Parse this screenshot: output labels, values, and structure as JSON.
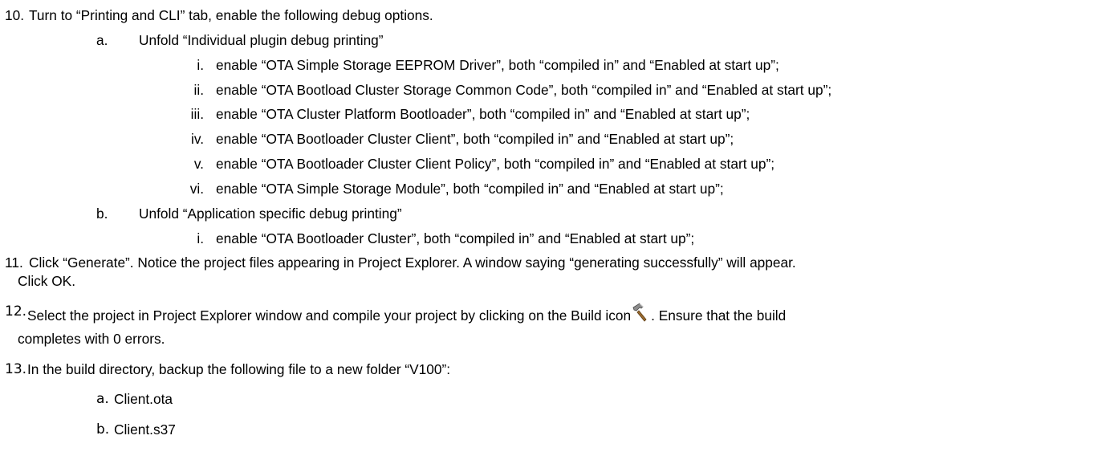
{
  "steps": [
    {
      "number": "10.",
      "text": "Turn to “Printing and CLI” tab, enable the following debug options.",
      "substeps": [
        {
          "marker": "a.",
          "text": "Unfold “Individual plugin debug printing”",
          "items": [
            {
              "marker": "i.",
              "text": "enable “OTA Simple Storage EEPROM Driver”, both “compiled in” and “Enabled at start up”;"
            },
            {
              "marker": "ii.",
              "text": "enable “OTA Bootload Cluster Storage Common Code”, both “compiled in” and “Enabled at start up”;"
            },
            {
              "marker": "iii.",
              "text": "enable “OTA Cluster Platform Bootloader”, both “compiled in” and “Enabled at start up”;"
            },
            {
              "marker": "iv.",
              "text": "enable “OTA Bootloader Cluster Client”, both “compiled in” and “Enabled at start up”;"
            },
            {
              "marker": "v.",
              "text": "enable “OTA Bootloader Cluster Client Policy”, both “compiled in” and “Enabled at start up”;"
            },
            {
              "marker": "vi.",
              "text": "enable “OTA Simple Storage Module”, both “compiled in” and “Enabled at start up”;"
            }
          ]
        },
        {
          "marker": "b.",
          "text": "Unfold “Application specific debug printing”",
          "items": [
            {
              "marker": "i.",
              "text": "enable “OTA Bootloader Cluster”, both “compiled in” and “Enabled at start up”;"
            }
          ]
        }
      ]
    },
    {
      "number": "11.",
      "text_line1": "Click “Generate”. Notice the project files appearing in Project Explorer. A window saying “generating successfully” will appear.",
      "text_line2": "Click OK."
    },
    {
      "number": "12.",
      "text_before_icon": "Select the project in Project Explorer window and compile your project by clicking on the Build icon",
      "icon": "hammer-build-icon",
      "text_after_icon": ". Ensure that the build",
      "text_line2": "completes with 0 errors."
    },
    {
      "number": "13.",
      "text": "In the build directory, backup the following file to a new folder “V100”:",
      "substeps": [
        {
          "marker": "a.",
          "text": "Client.ota"
        },
        {
          "marker": "b.",
          "text": "Client.s37"
        }
      ]
    }
  ]
}
